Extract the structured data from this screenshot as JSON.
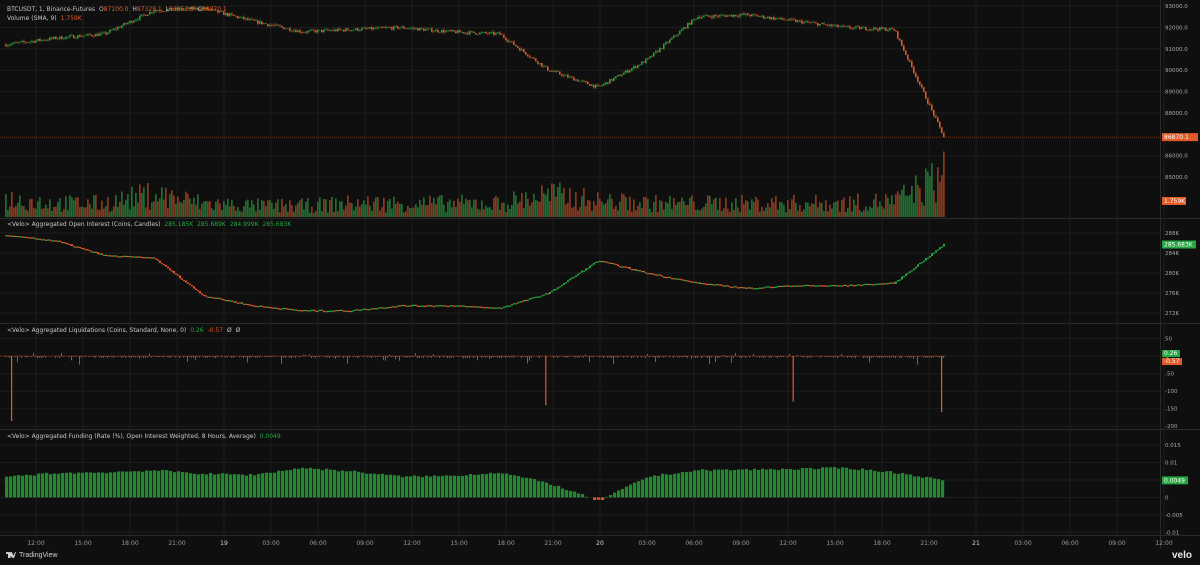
{
  "legends": {
    "price": {
      "symbol": "BTCUSDT, 1, Binance-Futures",
      "open_label": "O",
      "open": "87100.0",
      "high_label": "H",
      "high": "87328.1",
      "low_label": "L",
      "low": "86851.9",
      "close_label": "C",
      "close": "86870.1",
      "volume": "Volume (SMA, 9)",
      "volume_value": "1.759K"
    },
    "oi": {
      "title": "<Velo> Aggregated Open Interest (Coins, Candles)",
      "o": "285.185K",
      "h": "285.689K",
      "l": "284.999K",
      "c": "285.683K"
    },
    "liq": {
      "title": "<Velo> Aggregated Liquidations (Coins, Standard, None, 0)",
      "v1": "0.26",
      "v2": "-0.57",
      "v3": "Ø",
      "v4": "Ø"
    },
    "funding": {
      "title": "<Velo> Aggregated Funding (Rate (%), Open Interest Weighted, 8 Hours, Average)",
      "value": "0.0049"
    }
  },
  "brand": {
    "tradingview": "TradingView",
    "velo": "velo"
  },
  "colors": {
    "up": "#26a641",
    "down": "#e05a2a",
    "bg": "#0f0f0f",
    "grid": "#1d1d1d"
  },
  "chart_data": [
    {
      "type": "line",
      "title": "BTCUSDT, 1, Binance-Futures",
      "series_style": "candlestick",
      "x": [
        "12:00",
        "15:00",
        "18:00",
        "21:00",
        "19",
        "03:00",
        "06:00",
        "09:00",
        "12:00",
        "15:00",
        "18:00",
        "21:00",
        "20",
        "03:00",
        "06:00",
        "09:00",
        "12:00",
        "15:00",
        "18:00",
        "21:00"
      ],
      "y": [
        91200,
        91500,
        91700,
        92800,
        92900,
        92300,
        91800,
        91900,
        92000,
        91800,
        91700,
        90000,
        89200,
        90500,
        92500,
        92600,
        92300,
        92000,
        91900,
        86900
      ],
      "ylim": [
        85800,
        93100
      ],
      "yticks": [
        "93000.0",
        "92000.0",
        "91000.0",
        "90000.0",
        "89000.0",
        "88000.0",
        "86000.0",
        "85000.0"
      ],
      "last_price_label": "86870.1",
      "x_axis_ticks": [
        "12:00",
        "15:00",
        "18:00",
        "21:00",
        "19",
        "03:00",
        "06:00",
        "09:00",
        "12:00",
        "15:00",
        "18:00",
        "21:00",
        "20",
        "03:00",
        "06:00",
        "09:00",
        "12:00",
        "15:00",
        "18:00",
        "21:00",
        "21",
        "03:00",
        "06:00",
        "09:00",
        "12:00"
      ]
    },
    {
      "type": "bar",
      "title": "Volume (SMA, 9)",
      "y_last_label": "1.759K",
      "x": [
        "12:00",
        "15:00",
        "18:00",
        "21:00",
        "19",
        "03:00",
        "06:00",
        "09:00",
        "12:00",
        "15:00",
        "18:00",
        "21:00",
        "20",
        "03:00",
        "06:00",
        "09:00",
        "12:00",
        "15:00",
        "18:00",
        "21:00"
      ],
      "y": [
        0.4,
        0.3,
        0.3,
        0.5,
        0.3,
        0.25,
        0.25,
        0.3,
        0.3,
        0.3,
        0.3,
        0.5,
        0.35,
        0.3,
        0.3,
        0.3,
        0.3,
        0.3,
        0.35,
        0.9
      ]
    },
    {
      "type": "line",
      "title": "<Velo> Aggregated Open Interest (Coins, Candles)",
      "x": [
        "12:00",
        "15:00",
        "18:00",
        "21:00",
        "19",
        "03:00",
        "06:00",
        "09:00",
        "12:00",
        "15:00",
        "18:00",
        "21:00",
        "20",
        "03:00",
        "06:00",
        "09:00",
        "12:00",
        "15:00",
        "18:00",
        "21:00"
      ],
      "y": [
        287.5,
        286.5,
        283.5,
        283.0,
        275.5,
        273.5,
        272.5,
        272.5,
        273.5,
        273.5,
        273.0,
        276.0,
        282.5,
        280.0,
        278.0,
        277.0,
        277.5,
        277.5,
        278.0,
        285.7
      ],
      "yticks": [
        "288K",
        "284K",
        "280K",
        "276K",
        "272K"
      ],
      "ylim": [
        271,
        289
      ],
      "last_label": "285.683K"
    },
    {
      "type": "bar",
      "title": "<Velo> Aggregated Liquidations (Coins, Standard, None, 0)",
      "yticks": [
        "50",
        "0",
        "-50",
        "-100",
        "-150",
        "-200"
      ],
      "ylim": [
        -205,
        60
      ],
      "x": [
        "12:00",
        "15:00",
        "18:00",
        "21:00",
        "19",
        "03:00",
        "06:00",
        "09:00",
        "12:00",
        "15:00",
        "18:00",
        "21:00",
        "20",
        "03:00",
        "06:00",
        "09:00",
        "12:00",
        "15:00",
        "18:00",
        "21:00"
      ],
      "y": [
        -185,
        -5,
        -4,
        8,
        -3,
        -6,
        -20,
        -3,
        -2,
        -2,
        -3,
        -140,
        -15,
        -5,
        -4,
        -3,
        -130,
        -5,
        -3,
        -160
      ],
      "last_labels": [
        "0.26",
        "-0.57"
      ]
    },
    {
      "type": "bar",
      "title": "<Velo> Aggregated Funding (Rate (%), Open Interest Weighted, 8 Hours, Average)",
      "yticks": [
        "0.015",
        "0.01",
        "0.005",
        "0",
        "-0.005",
        "-0.01"
      ],
      "ylim": [
        -0.0105,
        0.0165
      ],
      "x": [
        "12:00",
        "15:00",
        "18:00",
        "21:00",
        "19",
        "03:00",
        "06:00",
        "09:00",
        "12:00",
        "15:00",
        "18:00",
        "21:00",
        "20",
        "03:00",
        "06:00",
        "09:00",
        "12:00",
        "15:00",
        "18:00",
        "21:00"
      ],
      "y": [
        0.006,
        0.007,
        0.0072,
        0.0078,
        0.0068,
        0.0065,
        0.0085,
        0.0075,
        0.006,
        0.0062,
        0.0072,
        0.004,
        -0.001,
        0.006,
        0.0078,
        0.008,
        0.0082,
        0.0085,
        0.0072,
        0.0049
      ],
      "last_label": "0.0049"
    }
  ]
}
